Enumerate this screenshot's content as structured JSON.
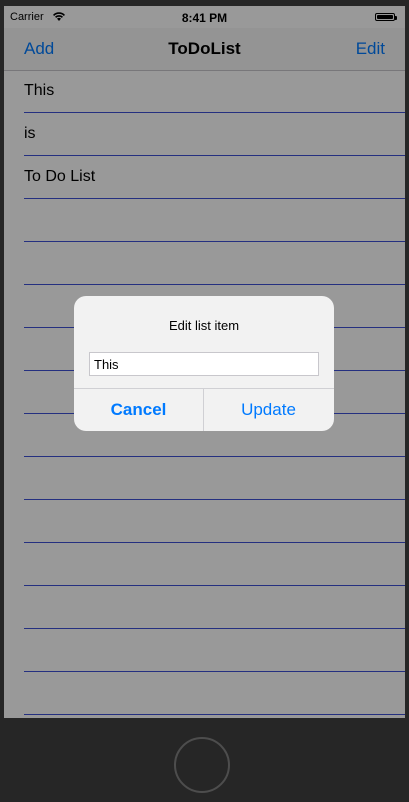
{
  "status_bar": {
    "carrier": "Carrier",
    "wifi_icon": "wifi-icon",
    "time": "8:41 PM",
    "battery_icon": "battery-icon"
  },
  "nav": {
    "left": "Add",
    "title": "ToDoList",
    "right": "Edit"
  },
  "list": {
    "items": [
      "This",
      "is",
      "To Do List",
      "",
      "",
      "",
      "",
      "",
      "",
      "",
      "",
      "",
      "",
      "",
      "",
      ""
    ]
  },
  "alert": {
    "title": "Edit list item",
    "input_value": "This",
    "cancel": "Cancel",
    "update": "Update"
  },
  "colors": {
    "accent": "#007aff",
    "separator": "#3f51d6",
    "frame": "#262626"
  }
}
